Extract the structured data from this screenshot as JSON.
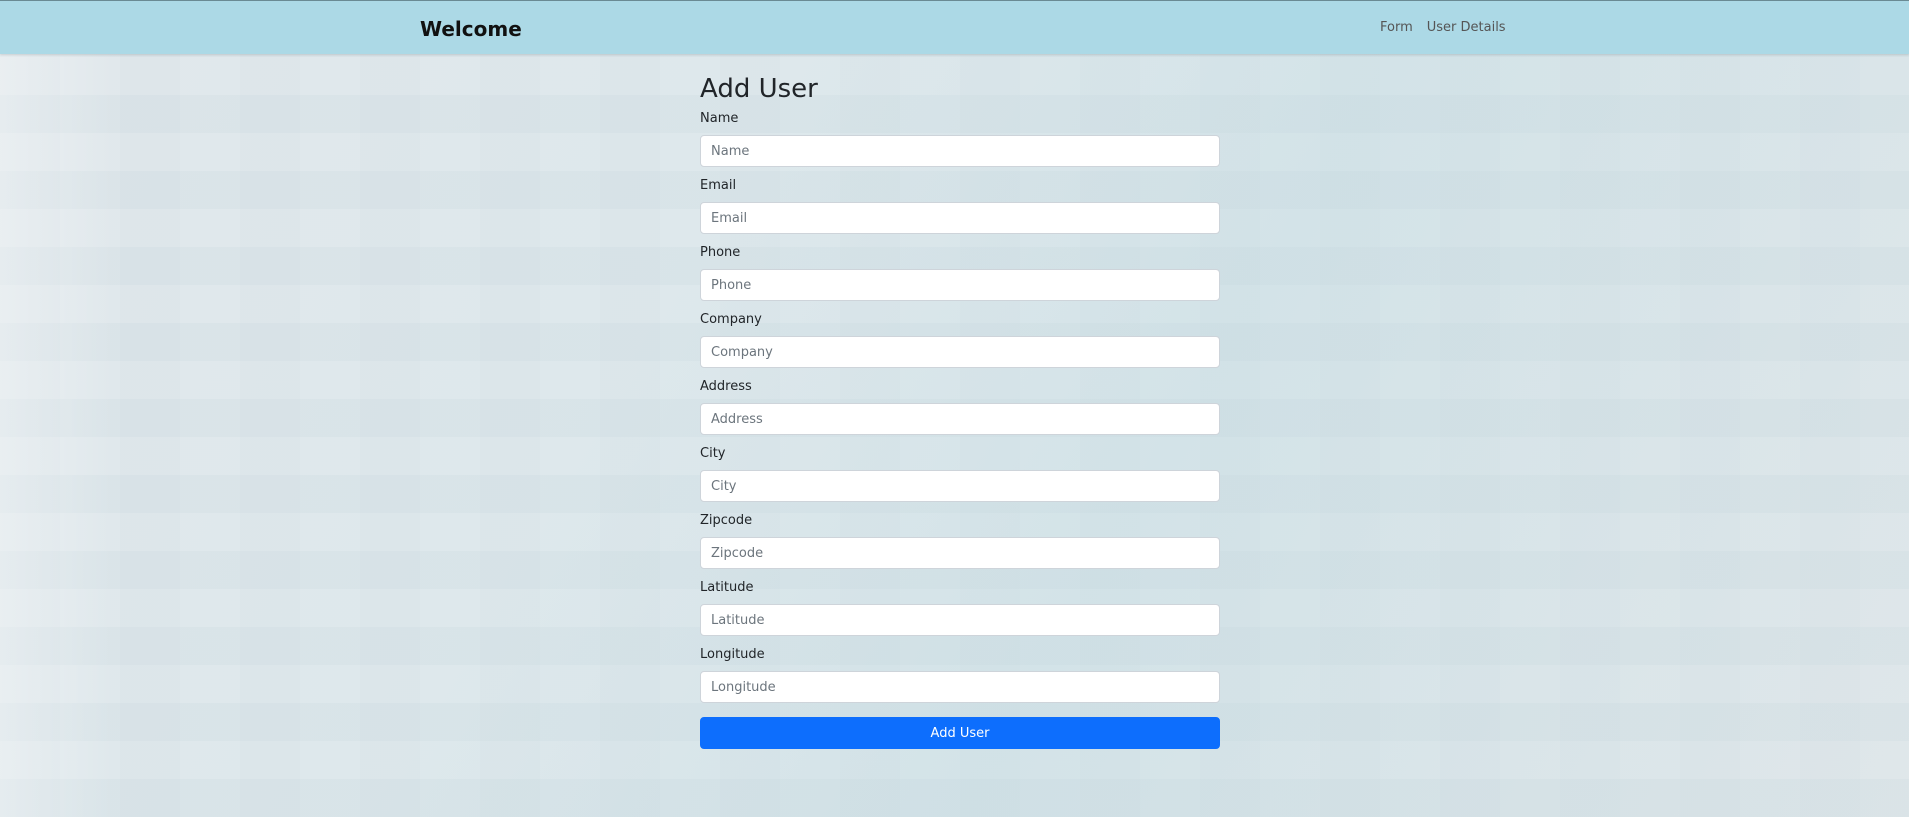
{
  "navbar": {
    "brand": "Welcome",
    "links": [
      "Form",
      "User Details"
    ]
  },
  "form": {
    "title": "Add User",
    "fields": [
      {
        "label": "Name",
        "placeholder": "Name"
      },
      {
        "label": "Email",
        "placeholder": "Email"
      },
      {
        "label": "Phone",
        "placeholder": "Phone"
      },
      {
        "label": "Company",
        "placeholder": "Company"
      },
      {
        "label": "Address",
        "placeholder": "Address"
      },
      {
        "label": "City",
        "placeholder": "City"
      },
      {
        "label": "Zipcode",
        "placeholder": "Zipcode"
      },
      {
        "label": "Latitude",
        "placeholder": "Latitude"
      },
      {
        "label": "Longitude",
        "placeholder": "Longitude"
      }
    ],
    "submit_label": "Add User"
  },
  "colors": {
    "navbar_bg": "#acd9e6",
    "primary": "#0d6efd"
  }
}
